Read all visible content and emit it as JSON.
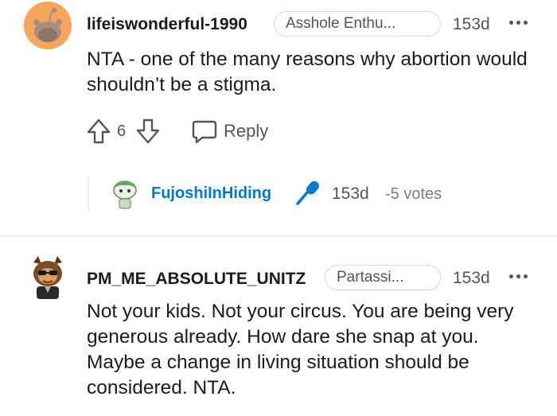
{
  "comments": [
    {
      "username": "lifeiswonderful-1990",
      "flair": "Asshole Enthu...",
      "age": "153d",
      "body": "NTA - one of the many reasons why abortion would shouldn’t be a stigma.",
      "vote_count": "6",
      "reply_label": "Reply",
      "avatar_color": "#f7a45d",
      "reply": {
        "username": "FujoshiInHiding",
        "age": "153d",
        "votes": "-5 votes"
      }
    },
    {
      "username": "PM_ME_ABSOLUTE_UNITZ",
      "flair": "Partassi...",
      "age": "153d",
      "body": "Not your kids. Not your circus. You are being very generous already. How dare she snap at you. Maybe a change in living situation should be considered. NTA."
    }
  ],
  "colors": {
    "accent": "#0079d3",
    "divider": "#edeff1",
    "muted_text": "#555555"
  },
  "icons": [
    "snoo-avatar-icon",
    "upvote-icon",
    "downvote-icon",
    "reply-bubble-icon",
    "more-dots-icon",
    "microphone-icon"
  ]
}
